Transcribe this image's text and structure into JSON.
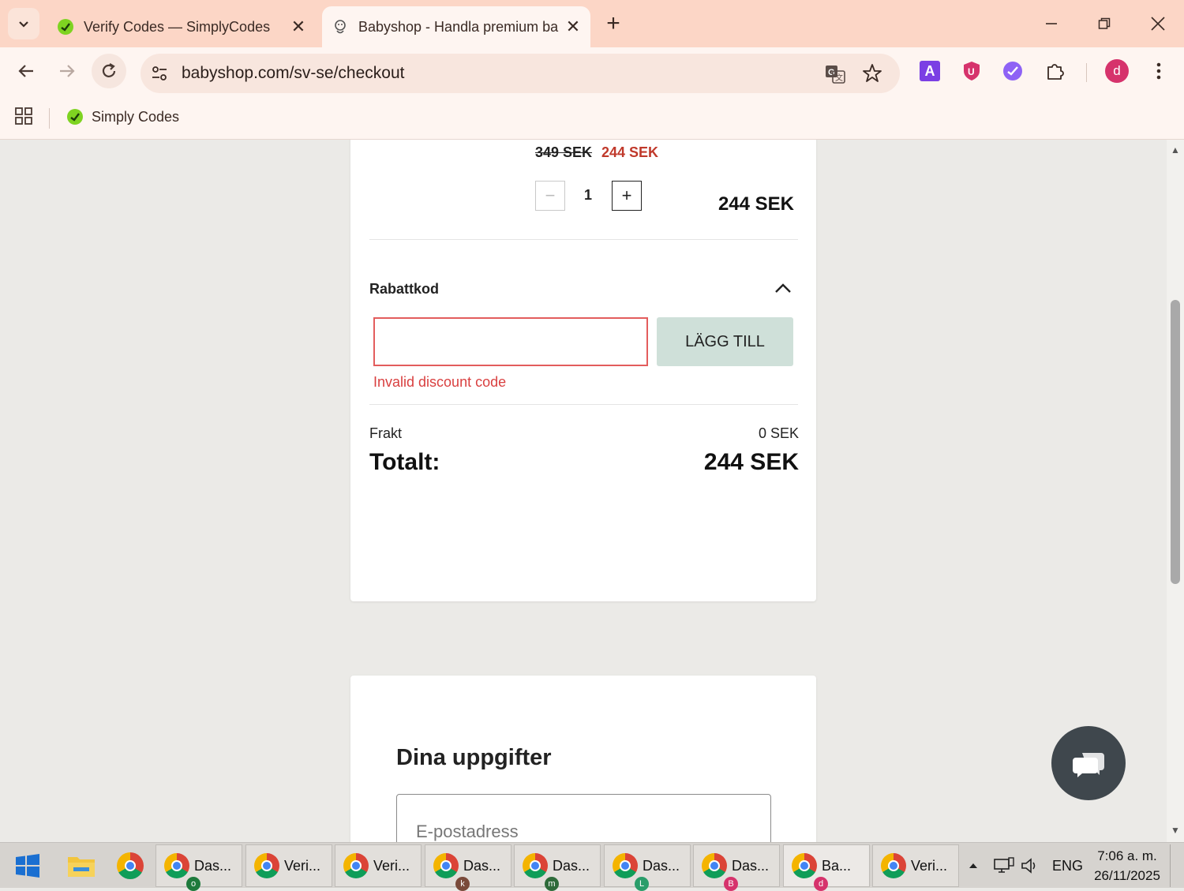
{
  "browser": {
    "tabs": [
      {
        "title": "Verify Codes — SimplyCodes",
        "active": false
      },
      {
        "title": "Babyshop - Handla premium ba",
        "active": true
      }
    ],
    "url": "babyshop.com/sv-se/checkout",
    "bookmarks": [
      {
        "label": "Simply Codes"
      }
    ],
    "profile_initial": "d",
    "extension_letters": {
      "a": "A",
      "u": "U"
    }
  },
  "cart": {
    "old_price": "349 SEK",
    "new_price": "244 SEK",
    "quantity": "1",
    "line_total": "244 SEK",
    "qty_minus": "−",
    "qty_plus": "+"
  },
  "discount": {
    "label": "Rabattkod",
    "input_value": "",
    "apply_label": "LÄGG TILL",
    "error": "Invalid discount code"
  },
  "summary": {
    "shipping_label": "Frakt",
    "shipping_value": "0 SEK",
    "total_label": "Totalt:",
    "total_value": "244 SEK"
  },
  "details": {
    "title": "Dina uppgifter",
    "email_placeholder": "E-postadress"
  },
  "taskbar": {
    "apps": [
      {
        "label": "Das...",
        "badge": "o",
        "badge_color": "#1e7a3c"
      },
      {
        "label": "Veri...",
        "badge": "",
        "badge_color": ""
      },
      {
        "label": "Veri...",
        "badge": "",
        "badge_color": ""
      },
      {
        "label": "Das...",
        "badge": "k",
        "badge_color": "#7a4a3a"
      },
      {
        "label": "Das...",
        "badge": "m",
        "badge_color": "#2e6b3a"
      },
      {
        "label": "Das...",
        "badge": "L",
        "badge_color": "#2a9d6a"
      },
      {
        "label": "Das...",
        "badge": "B",
        "badge_color": "#d6336c"
      },
      {
        "label": "Ba...",
        "badge": "d",
        "badge_color": "#d6336c"
      },
      {
        "label": "Veri...",
        "badge": "",
        "badge_color": ""
      }
    ],
    "language": "ENG",
    "time": "7:06 a. m.",
    "date": "26/11/2025"
  },
  "colors": {
    "titlebar": "#fcd6c6",
    "sale_price": "#c0392b",
    "error": "#d94040",
    "apply_button": "#cfe0d9",
    "chat_button": "#3f474d"
  }
}
